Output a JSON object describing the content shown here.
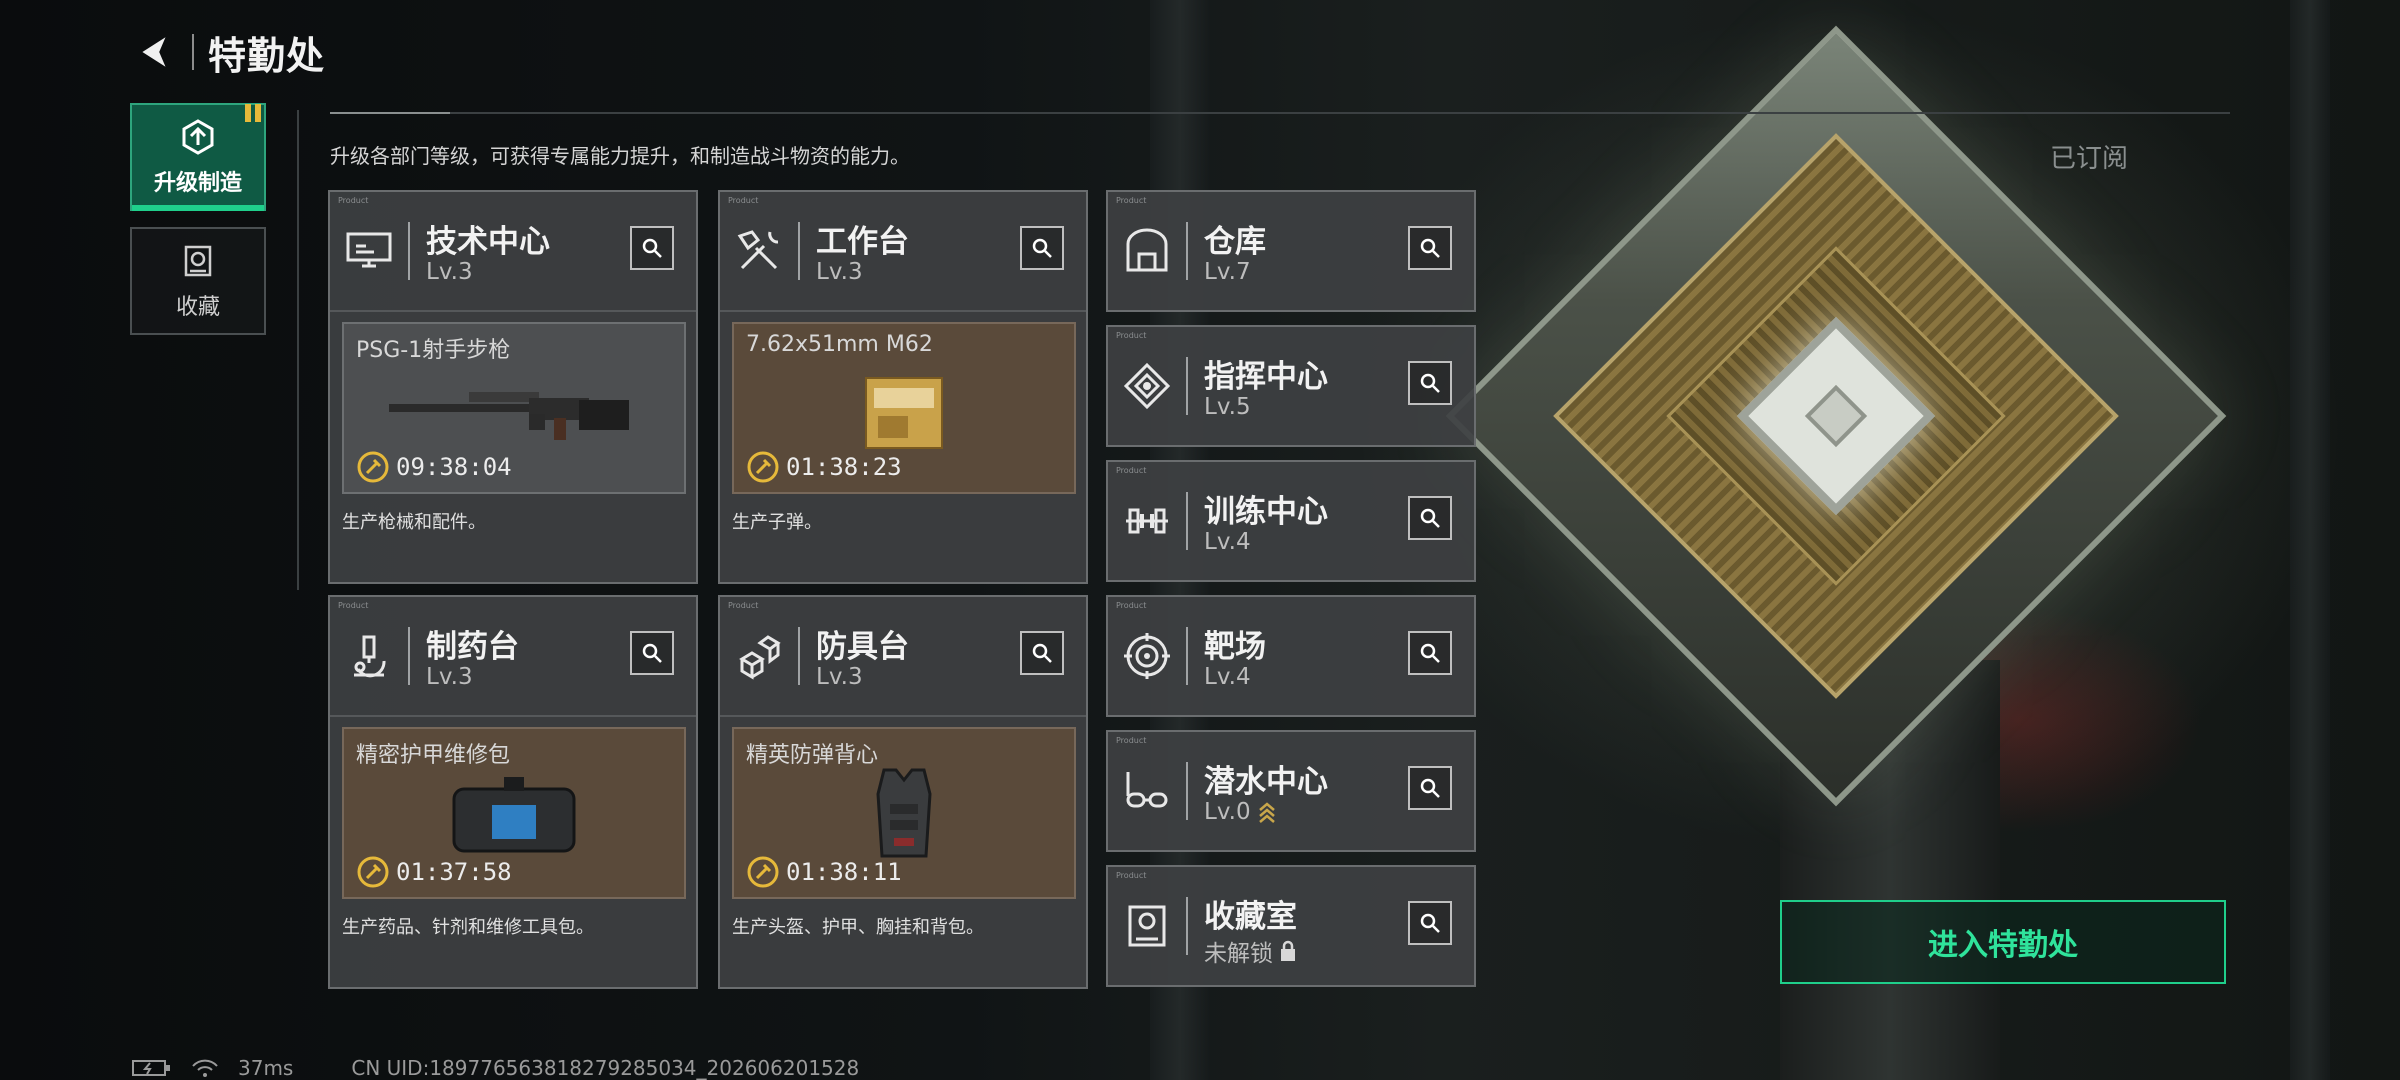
{
  "header": {
    "title": "特勤处"
  },
  "tabs": [
    {
      "label": "升级制造",
      "active": true
    },
    {
      "label": "收藏",
      "active": false
    }
  ],
  "description": "升级各部门等级，可获得专属能力提升，和制造战斗物资的能力。",
  "subscribed_label": "已订阅",
  "production_facilities": [
    {
      "name": "技术中心",
      "level": "Lv.3",
      "icon": "monitor-icon",
      "product": "PSG-1射手步枪",
      "timer": "09:38:04",
      "product_desc": "生产枪械和配件。"
    },
    {
      "name": "工作台",
      "level": "Lv.3",
      "icon": "tools-icon",
      "product": "7.62x51mm M62",
      "timer": "01:38:23",
      "product_desc": "生产子弹。"
    },
    {
      "name": "制药台",
      "level": "Lv.3",
      "icon": "microscope-icon",
      "product": "精密护甲维修包",
      "timer": "01:37:58",
      "product_desc": "生产药品、针剂和维修工具包。"
    },
    {
      "name": "防具台",
      "level": "Lv.3",
      "icon": "armor-blocks-icon",
      "product": "精英防弹背心",
      "timer": "01:38:11",
      "product_desc": "生产头盔、护甲、胸挂和背包。"
    }
  ],
  "other_facilities": [
    {
      "name": "仓库",
      "level": "Lv.7",
      "icon": "warehouse-icon"
    },
    {
      "name": "指挥中心",
      "level": "Lv.5",
      "icon": "command-icon"
    },
    {
      "name": "训练中心",
      "level": "Lv.4",
      "icon": "dumbbell-icon"
    },
    {
      "name": "靶场",
      "level": "Lv.4",
      "icon": "target-icon"
    },
    {
      "name": "潜水中心",
      "level": "Lv.0",
      "icon": "goggles-icon",
      "upgradable": true
    },
    {
      "name": "收藏室",
      "level": "未解锁",
      "icon": "collection-icon",
      "locked": true
    }
  ],
  "enter_button": "进入特勤处",
  "status_bar": {
    "ping": "37ms",
    "uid": "CN UID:18977656381827928503​4_202606201528"
  },
  "colors": {
    "accent": "#1fcf8b",
    "card_bg": "#3e4042",
    "product_bg": "#5a4a3a",
    "badge": "#e6b93a"
  }
}
